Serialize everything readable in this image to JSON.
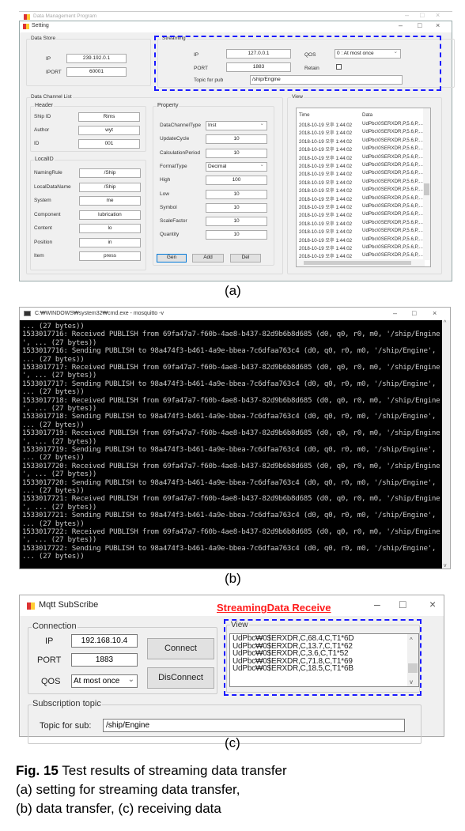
{
  "panel_a": {
    "ghost_title": "Data Management Program",
    "title": "Setting",
    "data_store": {
      "label": "Data Store",
      "ip_label": "IP",
      "ip": "239.192.0.1",
      "port_label": "IPORT",
      "port": "60001"
    },
    "streaming": {
      "label": "Streaming",
      "ip_label": "IP",
      "ip": "127.0.0.1",
      "port_label": "PORT",
      "port": "1883",
      "topic_label": "Topic for pub",
      "topic": "/ship/Engine",
      "qos_label": "QOS",
      "qos": "0 : At most once",
      "retain_label": "Retain",
      "retain_checked": false
    },
    "channel_list_label": "Data Channel List",
    "header": {
      "label": "Header",
      "fields": [
        {
          "label": "Ship ID",
          "value": "Rims"
        },
        {
          "label": "Author",
          "value": "wyt"
        },
        {
          "label": "ID",
          "value": "001"
        }
      ]
    },
    "local_id": {
      "label": "LocalID",
      "fields": [
        {
          "label": "NamingRule",
          "value": "/Ship"
        },
        {
          "label": "LocalDataName",
          "value": "/Ship"
        },
        {
          "label": "System",
          "value": "me"
        },
        {
          "label": "Component",
          "value": "lubrication"
        },
        {
          "label": "Content",
          "value": "lo"
        },
        {
          "label": "Position",
          "value": "in"
        },
        {
          "label": "Item",
          "value": "press"
        }
      ]
    },
    "property": {
      "label": "Property",
      "fields": [
        {
          "label": "DataChannelType",
          "value": "Inst",
          "select": true
        },
        {
          "label": "UpdateCycle",
          "value": "10"
        },
        {
          "label": "CalculationPeriod",
          "value": "10"
        },
        {
          "label": "FormatType",
          "value": "Decimal",
          "select": true
        },
        {
          "label": "High",
          "value": "100"
        },
        {
          "label": "Low",
          "value": "10"
        },
        {
          "label": "Symbol",
          "value": "10"
        },
        {
          "label": "ScaleFactor",
          "value": "10"
        },
        {
          "label": "Quantity",
          "value": "10"
        }
      ]
    },
    "buttons": {
      "gen": "Gen",
      "add": "Add",
      "del": "Del"
    },
    "view": {
      "label": "View",
      "col_time": "Time",
      "col_data": "Data",
      "row_time": "2018-10-19 오후 1:44:02",
      "row_data": "UdPbc\\0SERXDR,P,5.6,P,...",
      "row_count": 17
    }
  },
  "panel_b": {
    "title": "C:₩WINDOWS₩system32₩cmd.exe - mosquitto  -v",
    "lines": [
      "... (27 bytes))",
      "1533017716: Received PUBLISH from 69fa47a7-f60b-4ae8-b437-82d9b6b8d685 (d0, q0, r0, m0, '/ship/Engine",
      "', ... (27 bytes))",
      "1533017716: Sending PUBLISH to 98a474f3-b461-4a9e-bbea-7c6dfaa763c4 (d0, q0, r0, m0, '/ship/Engine',",
      "... (27 bytes))",
      "1533017717: Received PUBLISH from 69fa47a7-f60b-4ae8-b437-82d9b6b8d685 (d0, q0, r0, m0, '/ship/Engine",
      "', ... (27 bytes))",
      "1533017717: Sending PUBLISH to 98a474f3-b461-4a9e-bbea-7c6dfaa763c4 (d0, q0, r0, m0, '/ship/Engine',",
      "... (27 bytes))",
      "1533017718: Received PUBLISH from 69fa47a7-f60b-4ae8-b437-82d9b6b8d685 (d0, q0, r0, m0, '/ship/Engine",
      "', ... (27 bytes))",
      "1533017718: Sending PUBLISH to 98a474f3-b461-4a9e-bbea-7c6dfaa763c4 (d0, q0, r0, m0, '/ship/Engine',",
      "... (27 bytes))",
      "1533017719: Received PUBLISH from 69fa47a7-f60b-4ae8-b437-82d9b6b8d685 (d0, q0, r0, m0, '/ship/Engine",
      "', ... (27 bytes))",
      "1533017719: Sending PUBLISH to 98a474f3-b461-4a9e-bbea-7c6dfaa763c4 (d0, q0, r0, m0, '/ship/Engine',",
      "... (27 bytes))",
      "1533017720: Received PUBLISH from 69fa47a7-f60b-4ae8-b437-82d9b6b8d685 (d0, q0, r0, m0, '/ship/Engine",
      "', ... (27 bytes))",
      "1533017720: Sending PUBLISH to 98a474f3-b461-4a9e-bbea-7c6dfaa763c4 (d0, q0, r0, m0, '/ship/Engine',",
      "... (27 bytes))",
      "1533017721: Received PUBLISH from 69fa47a7-f60b-4ae8-b437-82d9b6b8d685 (d0, q0, r0, m0, '/ship/Engine",
      "', ... (27 bytes))",
      "1533017721: Sending PUBLISH to 98a474f3-b461-4a9e-bbea-7c6dfaa763c4 (d0, q0, r0, m0, '/ship/Engine',",
      "... (27 bytes))",
      "1533017722: Received PUBLISH from 69fa47a7-f60b-4ae8-b437-82d9b6b8d685 (d0, q0, r0, m0, '/ship/Engine",
      "', ... (27 bytes))",
      "1533017722: Sending PUBLISH to 98a474f3-b461-4a9e-bbea-7c6dfaa763c4 (d0, q0, r0, m0, '/ship/Engine',",
      "... (27 bytes))"
    ]
  },
  "panel_c": {
    "title": "Mqtt SubScribe",
    "annotation": "StreamingData Receive",
    "annotation_color": "#ff1a1a",
    "connection": {
      "label": "Connection",
      "ip_label": "IP",
      "ip": "192.168.10.4",
      "port_label": "PORT",
      "port": "1883",
      "qos_label": "QOS",
      "qos": "At most once"
    },
    "connect": "Connect",
    "disconnect": "DisConnect",
    "view_label": "View",
    "view_lines": [
      "UdPbc₩0$ERXDR,C,68.4,C,T1*6D",
      "UdPbc₩0$ERXDR,C,13.7,C,T1*62",
      "UdPbc₩0$ERXDR,C,3.6,C,T1*52",
      "UdPbc₩0$ERXDR,C,71.8,C,T1*69",
      "UdPbc₩0$ERXDR,C,18.5,C,T1*6B"
    ],
    "subscription": {
      "label": "Subscription topic",
      "topic_label": "Topic for sub:",
      "topic": "/ship/Engine"
    }
  },
  "captions": {
    "a": "(a)",
    "b": "(b)",
    "c": "(c)"
  },
  "figure_caption": {
    "fig": "Fig. 15",
    "title": " Test results of streaming data transfer",
    "line2": "(a) setting for streaming data transfer,",
    "line3": "(b) data transfer, (c) receiving data"
  },
  "highlight_color": "#1a1aff"
}
